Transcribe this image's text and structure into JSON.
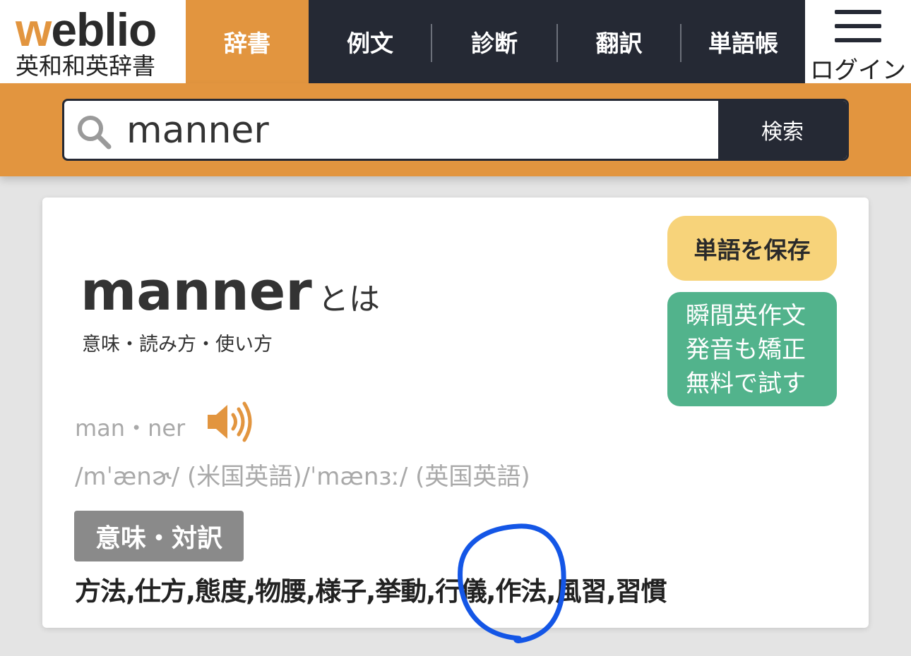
{
  "logo": {
    "brand_first": "w",
    "brand_rest": "eblio",
    "subtitle": "英和和英辞書"
  },
  "nav": {
    "tabs": [
      {
        "label": "辞書",
        "active": true
      },
      {
        "label": "例文",
        "active": false
      },
      {
        "label": "診断",
        "active": false
      },
      {
        "label": "翻訳",
        "active": false
      },
      {
        "label": "単語帳",
        "active": false
      }
    ],
    "login_label": "ログイン",
    "menu_icon": "hamburger-menu-icon"
  },
  "search": {
    "value": "manner",
    "button_label": "検索",
    "icon": "search-icon"
  },
  "entry": {
    "headword": "manner",
    "headword_suffix": "とは",
    "subtitle": "意味・読み方・使い方",
    "syllables": "man・ner",
    "pronunciation": "/mˈænɚ/ (米国英語)/ˈmænɜː/ (英国英語)",
    "speaker_icon": "speaker-icon",
    "meaning_badge": "意味・対訳",
    "meanings": "方法,仕方,態度,物腰,様子,挙動,行儀,作法,風習,習慣"
  },
  "actions": {
    "save_word": "単語を保存",
    "promo_lines": [
      "瞬間英作文",
      "発音も矯正",
      "無料で試す"
    ]
  },
  "colors": {
    "brand_orange": "#e2953f",
    "nav_dark": "#252934",
    "save_yellow": "#f7d37a",
    "promo_green": "#52b38c",
    "annotation_blue": "#1456e6"
  }
}
